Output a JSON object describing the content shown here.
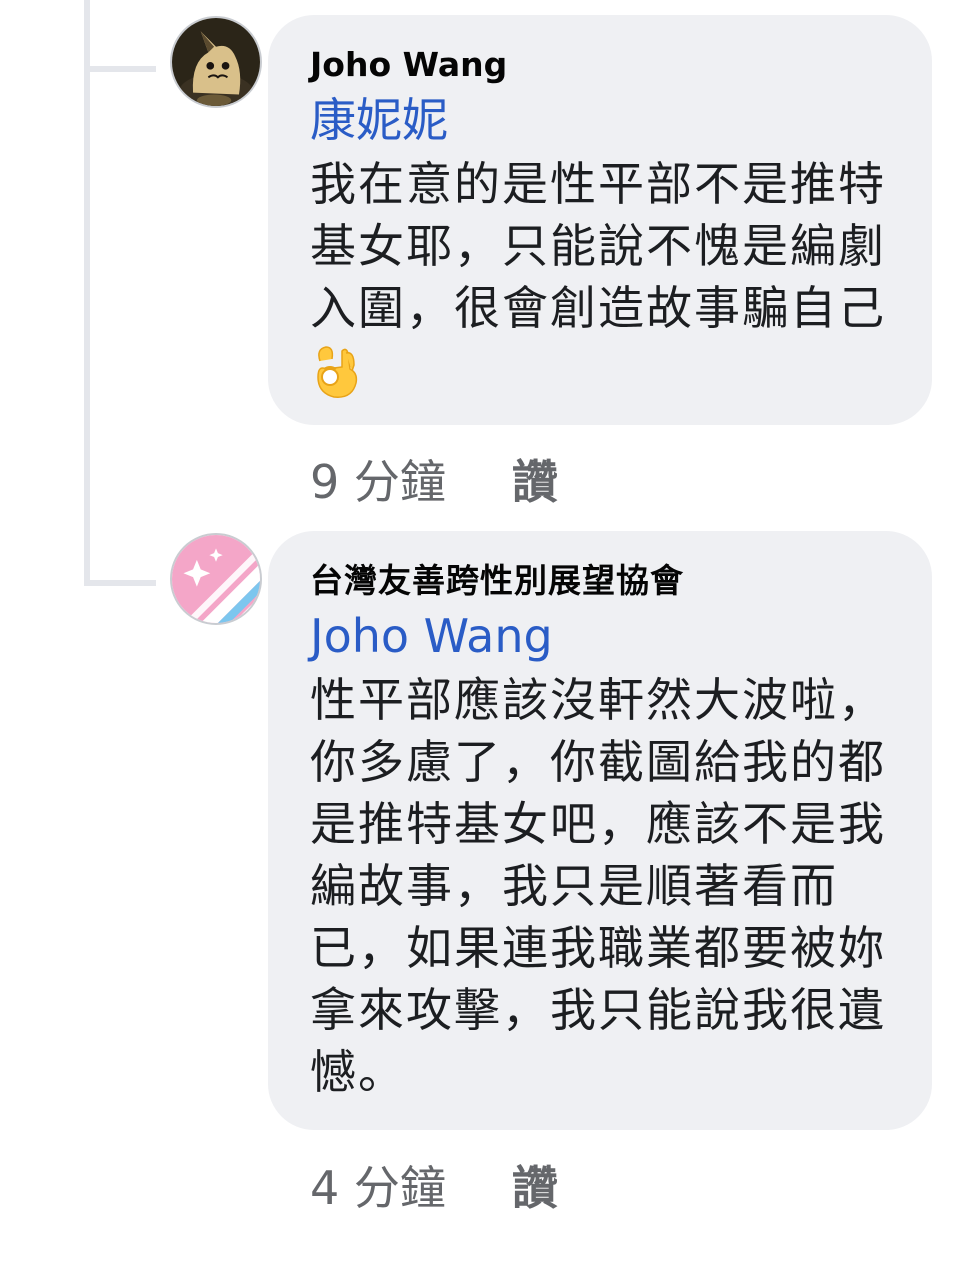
{
  "comments": [
    {
      "author": "Joho Wang",
      "mention": "康妮妮",
      "text": "我在意的是性平部不是推特基女耶，只能說不愧是編劇入圍，很會創造故事騙自己",
      "emoji_name": "ok-hand-emoji",
      "time": "9 分鐘",
      "like_label": "讚",
      "avatar_icon": "mimikyu-avatar"
    },
    {
      "author": "台灣友善跨性別展望協會",
      "mention": "Joho Wang",
      "text": "性平部應該沒軒然大波啦，你多慮了，你截圖給我的都是推特基女吧，應該不是我編故事，我只是順著看而已，如果連我職業都要被妳拿來攻擊，我只能說我很遺憾。",
      "time": "4 分鐘",
      "like_label": "讚",
      "avatar_icon": "trans-flag-stripes-avatar"
    }
  ],
  "colors": {
    "bubble": "#eff0f3",
    "mention": "#2a5cc6",
    "meta": "#65676b",
    "thread_line": "#e4e6eb"
  }
}
